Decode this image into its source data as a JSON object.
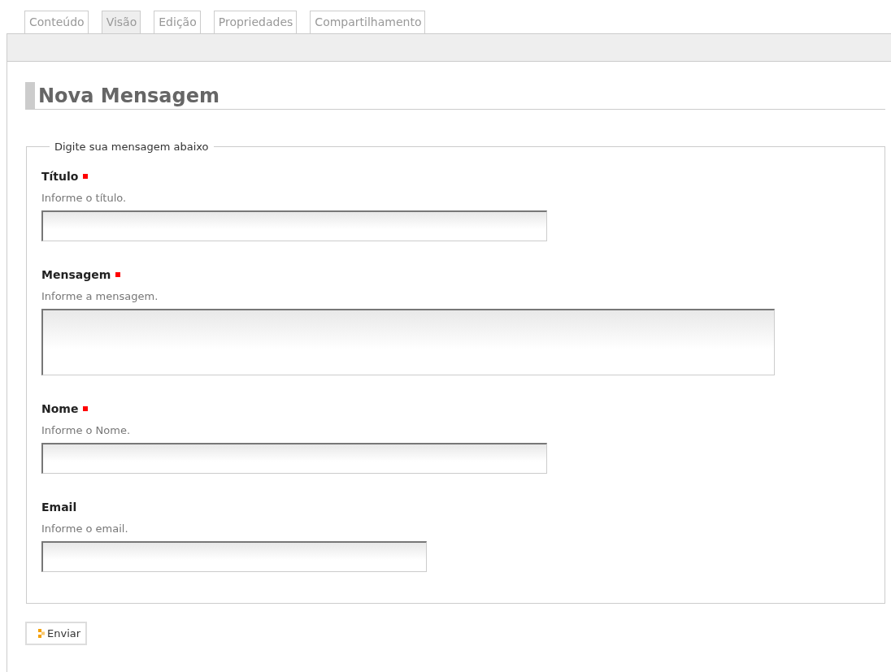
{
  "tabs": [
    {
      "label": "Conteúdo",
      "selected": false
    },
    {
      "label": "Visão",
      "selected": true
    },
    {
      "label": "Edição",
      "selected": false
    },
    {
      "label": "Propriedades",
      "selected": false
    },
    {
      "label": "Compartilhamento",
      "selected": false
    }
  ],
  "heading": "Nova Mensagem",
  "form": {
    "legend": "Digite sua mensagem abaixo",
    "fields": [
      {
        "label": "Título",
        "required": true,
        "help": "Informe o título.",
        "kind": "text"
      },
      {
        "label": "Mensagem",
        "required": true,
        "help": "Informe a mensagem.",
        "kind": "textarea"
      },
      {
        "label": "Nome",
        "required": true,
        "help": "Informe o Nome.",
        "kind": "text"
      },
      {
        "label": "Email",
        "required": false,
        "help": "Informe o email.",
        "kind": "email"
      }
    ]
  },
  "submit_button": "Enviar"
}
